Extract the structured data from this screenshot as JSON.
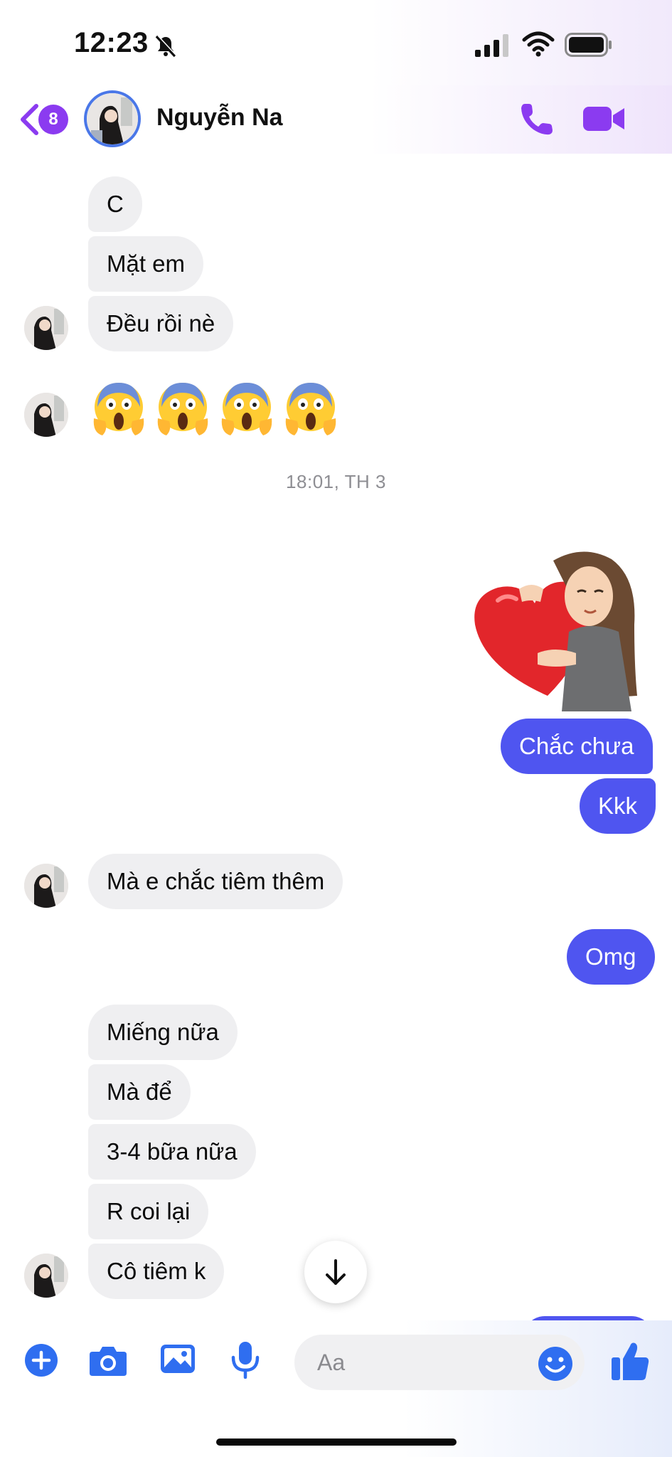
{
  "status_bar": {
    "time": "12:23"
  },
  "header": {
    "back_badge_count": "8",
    "contact_name": "Nguyễn Na"
  },
  "messages": {
    "m1": "C",
    "m2": "Mặt em",
    "m3": "Đều rồi nè",
    "emoji_reactions": [
      "😱",
      "😱",
      "😱",
      "😱"
    ],
    "timestamp": "18:01, TH 3",
    "m4": "Chắc chưa",
    "m5": "Kkk",
    "m6": "Mà e chắc tiêm thêm",
    "m7": "Omg",
    "m8": "Miếng nữa",
    "m9": "Mà để",
    "m10": "3-4 bữa nữa",
    "m11": "R coi lại",
    "m12": "Cô tiêm k"
  },
  "composer": {
    "placeholder": "Aa"
  },
  "colors": {
    "accent": "#8b3bf0",
    "outgoing_bubble": "#4f55f0",
    "incoming_bubble": "#efeff1",
    "composer_icon": "#2f6ef0"
  }
}
